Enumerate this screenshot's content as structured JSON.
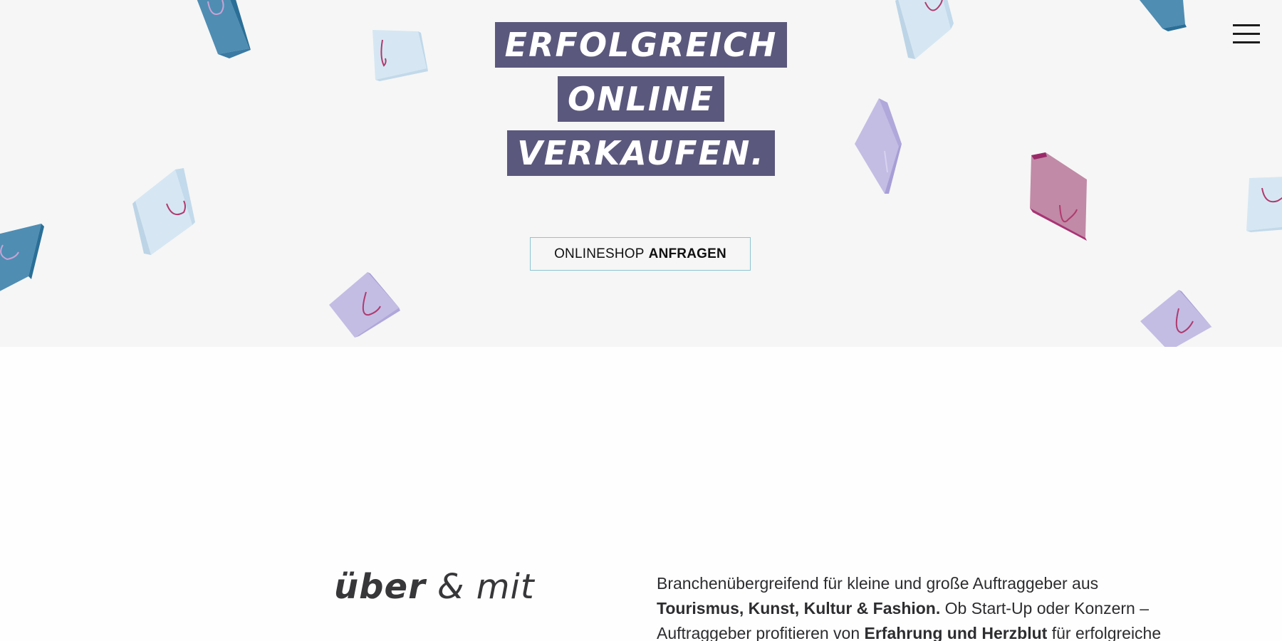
{
  "hero": {
    "headline": [
      "ERFOLGREICH",
      "ONLINE",
      "VERKAUFEN."
    ],
    "cta": {
      "label_regular": "ONLINESHOP",
      "label_bold": "ANFRAGEN"
    },
    "background_color": "#f6f6f6",
    "headline_bg_color": "#5b587d",
    "cta_border_color": "#8cc5d3"
  },
  "header": {
    "menu_icon": "hamburger-menu-icon"
  },
  "bag_colors": {
    "dark_blue": "#4f8db3",
    "light_blue": "#d6e7f3",
    "lavender": "#c3bde4",
    "pink": "#c18aa6",
    "handle": "#b03a6e"
  },
  "about": {
    "heading_bold": "über",
    "heading_light": "& mit",
    "text": {
      "p1": "Branchenübergreifend für kleine und große Auftraggeber aus ",
      "b1": "Tourismus, Kunst, Kultur & Fashion.",
      "p2": " Ob Start-Up oder Konzern – Auftraggeber profitieren von ",
      "b2": "Erfahrung und Herzblut",
      "p3": " für erfolgreiche"
    }
  }
}
